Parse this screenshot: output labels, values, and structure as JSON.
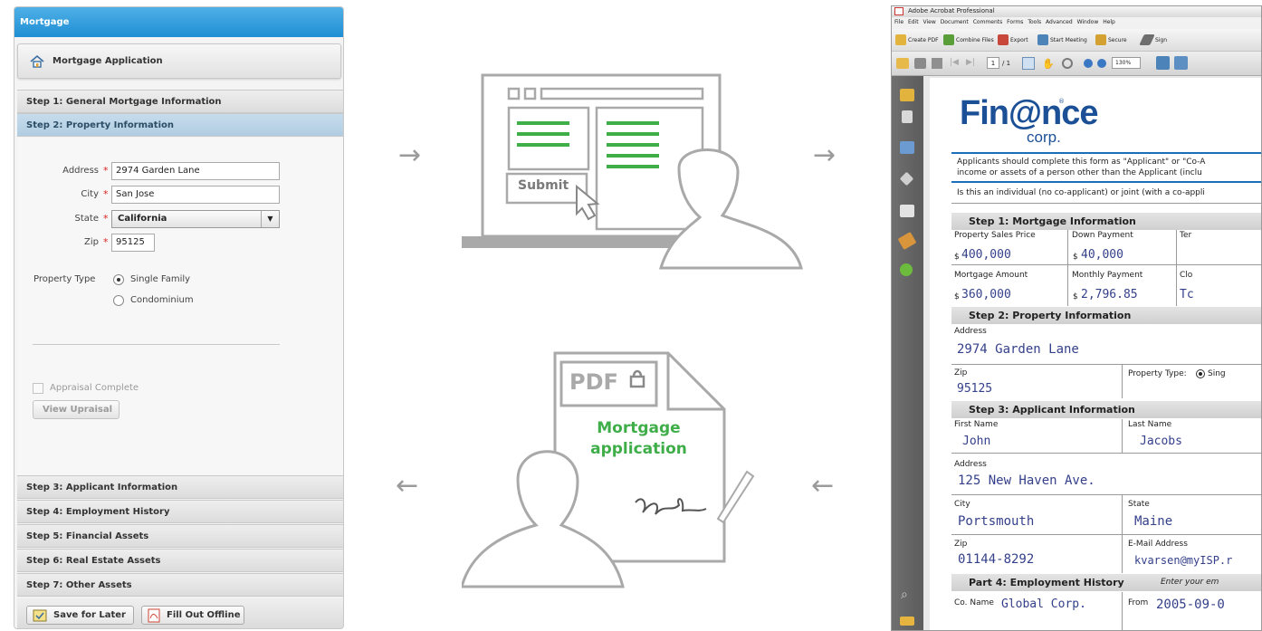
{
  "left": {
    "window_title": "Mortgage",
    "app_title": "Mortgage Application",
    "steps_top": [
      {
        "label": "Step 1: General Mortgage Information",
        "active": false
      },
      {
        "label": "Step 2: Property Information",
        "active": true
      }
    ],
    "form": {
      "address_label": "Address",
      "address_value": "2974 Garden Lane",
      "city_label": "City",
      "city_value": "San Jose",
      "state_label": "State",
      "state_value": "California",
      "zip_label": "Zip",
      "zip_value": "95125",
      "required_mark": "*",
      "property_type_label": "Property Type",
      "property_options": [
        {
          "label": "Single Family",
          "selected": true
        },
        {
          "label": "Condominium",
          "selected": false
        }
      ],
      "appraisal_label": "Appraisal Complete",
      "view_upraisal_label": "View Upraisal"
    },
    "steps_bottom": [
      {
        "label": "Step 3: Applicant Information"
      },
      {
        "label": "Step 4: Employment History"
      },
      {
        "label": "Step 5: Financial Assets"
      },
      {
        "label": "Step 6: Real Estate Assets"
      },
      {
        "label": "Step 7: Other Assets"
      }
    ],
    "footer": {
      "save_label": "Save for Later",
      "offline_label": "Fill Out Offline"
    },
    "accent": "#1f8fd4"
  },
  "middle": {
    "submit_label": "Submit",
    "pdf_label": "PDF",
    "doc_title_line1": "Mortgage",
    "doc_title_line2": "application",
    "arrow_right": "→",
    "arrow_left": "←",
    "green": "#3fae49",
    "gray": "#a9a9a9"
  },
  "acrobat": {
    "window_title": "Adobe Acrobat Professional",
    "menu": [
      "File",
      "Edit",
      "View",
      "Document",
      "Comments",
      "Forms",
      "Tools",
      "Advanced",
      "Window",
      "Help"
    ],
    "toolbar1": [
      "Create PDF",
      "Combine Files",
      "Export",
      "Start Meeting",
      "Secure",
      "Sign"
    ],
    "page_number": "1",
    "page_total": "/ 1",
    "zoom": "130%",
    "sidebar_icons": [
      "pages-icon",
      "bookmarks-icon",
      "layers-icon",
      "edit-icon",
      "tag-icon",
      "help-icon",
      "attachment-icon",
      "comment-icon"
    ],
    "doc": {
      "logo_main": "Fin@nce",
      "logo_sub": "corp.",
      "registered": "®",
      "intro_line1": "Applicants should complete this form as \"Applicant\" or \"Co-A",
      "intro_line2": "income or assets of a person other than the Applicant (inclu",
      "question": "Is this an individual (no co-applicant) or joint (with a co-appli",
      "step1_title": "Step 1: Mortgage Information",
      "property_sales_price_label": "Property Sales Price",
      "property_sales_price_value": "400,000",
      "down_payment_label": "Down Payment",
      "down_payment_value": "40,000",
      "term_label": "Ter",
      "currency": "$",
      "mortgage_amount_label": "Mortgage Amount",
      "mortgage_amount_value": "360,000",
      "monthly_payment_label": "Monthly Payment",
      "monthly_payment_value": "2,796.85",
      "closing_label": "Clo",
      "closing_value": "Tc",
      "step2_title": "Step 2: Property Information",
      "address_label": "Address",
      "address_value": "2974 Garden Lane",
      "zip_label": "Zip",
      "zip_value": "95125",
      "property_type_label": "Property Type:",
      "property_type_value": "Sing",
      "step3_title": "Step 3: Applicant Information",
      "first_name_label": "First Name",
      "first_name_value": "John",
      "last_name_label": "Last Name",
      "last_name_value": "Jacobs",
      "app_address_label": "Address",
      "app_address_value": "125 New Haven Ave.",
      "city_label": "City",
      "city_value": "Portsmouth",
      "state_label": "State",
      "state_value": "Maine",
      "app_zip_label": "Zip",
      "app_zip_value": "01144-8292",
      "email_label": "E-Mail Address",
      "email_value": "kvarsen@myISP.r",
      "part4_title": "Part 4: Employment History",
      "part4_note": "Enter your em",
      "co_name_label": "Co. Name",
      "co_name_value": "Global Corp.",
      "from_label": "From",
      "from_value": "2005-09-0"
    },
    "logo_blue": "#1b4f96"
  }
}
